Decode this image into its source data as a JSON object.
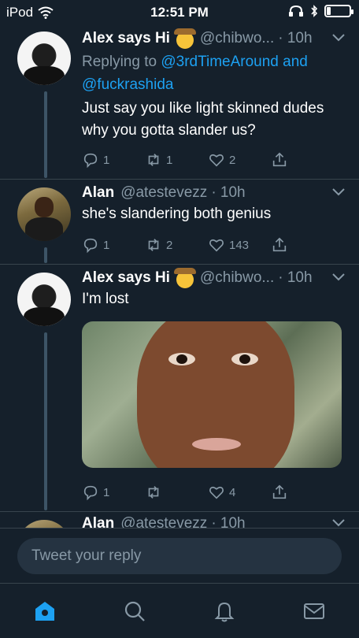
{
  "status_bar": {
    "carrier": "iPod",
    "time": "12:51 PM"
  },
  "tweets": [
    {
      "name": "Alex says Hi",
      "handle": "@chibwo...",
      "time": "· 10h",
      "replying_prefix": "Replying to",
      "replying_to_1": "@3rdTimeAround",
      "replying_and": "and",
      "replying_to_2": "@fuckrashida",
      "text": "Just say you like light skinned dudes why you gotta slander us?",
      "replies": "1",
      "retweets": "1",
      "likes": "2"
    },
    {
      "name": "Alan",
      "handle": "@atestevezz",
      "time": "· 10h",
      "text": "she's slandering both genius",
      "replies": "1",
      "retweets": "2",
      "likes": "143"
    },
    {
      "name": "Alex says Hi",
      "handle": "@chibwo...",
      "time": "· 10h",
      "text": "I'm lost",
      "replies": "1",
      "retweets": "",
      "likes": "4"
    },
    {
      "name": "Alan",
      "handle": "@atestevezz",
      "time": "· 10h"
    }
  ],
  "reply_box": {
    "placeholder": "Tweet your reply"
  },
  "tabs": [
    "home-icon",
    "search-icon",
    "notifications-icon",
    "messages-icon"
  ],
  "colors": {
    "accent": "#1da1f2",
    "background": "#15202b",
    "muted": "#8899a6"
  }
}
